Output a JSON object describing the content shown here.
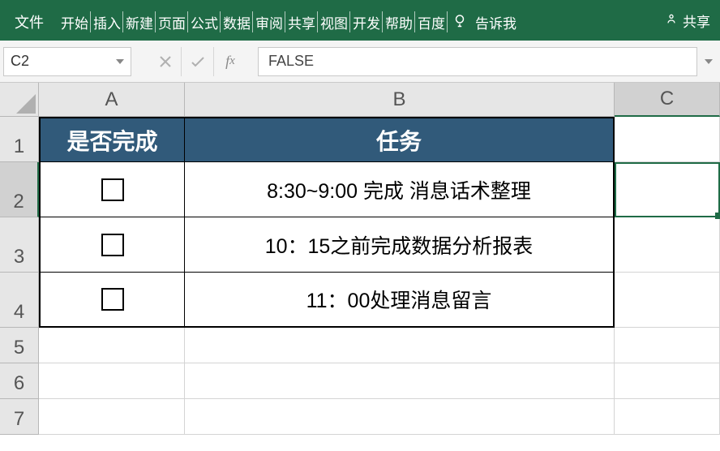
{
  "ribbon": {
    "tabs": [
      "文件",
      "开始",
      "插入",
      "新建",
      "页面",
      "公式",
      "数据",
      "审阅",
      "共享",
      "视图",
      "开发",
      "帮助",
      "百度"
    ],
    "tell_me": "告诉我",
    "share": "共享"
  },
  "formula_bar": {
    "name_box": "C2",
    "value": "FALSE"
  },
  "columns": [
    "A",
    "B",
    "C"
  ],
  "active_cell": "C2",
  "table": {
    "header": {
      "col_a": "是否完成",
      "col_b": "任务"
    },
    "rows": [
      {
        "done_checked": false,
        "task": "8:30~9:00 完成 消息话术整理"
      },
      {
        "done_checked": false,
        "task": "10：15之前完成数据分析报表"
      },
      {
        "done_checked": false,
        "task": "11：00处理消息留言"
      }
    ]
  },
  "row_numbers": [
    1,
    2,
    3,
    4,
    5,
    6,
    7
  ]
}
